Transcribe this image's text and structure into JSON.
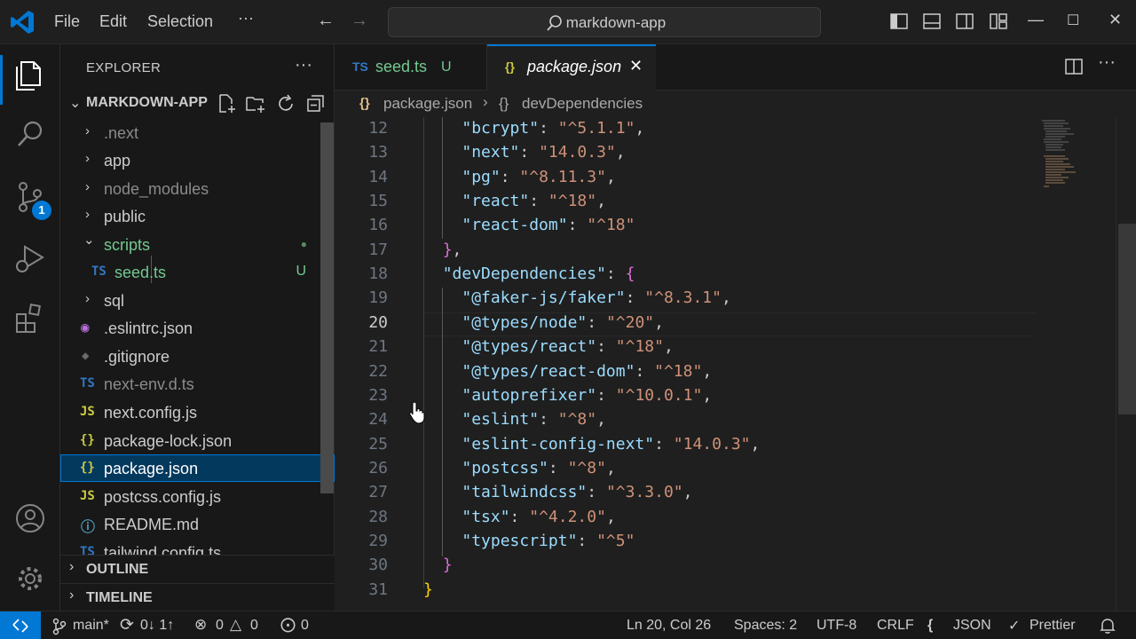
{
  "titlebar": {
    "menus": [
      "File",
      "Edit",
      "Selection",
      "···"
    ],
    "search_text": "markdown-app",
    "icons": [
      "vscode-logo-icon",
      "back-arrow-icon",
      "forward-arrow-icon",
      "search-icon",
      "toggle-primary-sidebar-icon",
      "toggle-panel-icon",
      "toggle-secondary-sidebar-icon",
      "customize-layout-icon"
    ],
    "window_controls": {
      "minimize": "—",
      "maximize": "☐",
      "close": "✕"
    }
  },
  "activitybar": {
    "items": [
      "explorer-icon",
      "search-icon",
      "source-control-icon",
      "run-debug-icon",
      "extensions-icon"
    ],
    "source_control_badge": "1",
    "bottom": [
      "accounts-icon",
      "settings-gear-icon"
    ]
  },
  "sidebar": {
    "title": "EXPLORER",
    "more": "···",
    "project": "MARKDOWN-APP",
    "items": [
      {
        "name": ".next",
        "type": "folder",
        "muted": true
      },
      {
        "name": "app",
        "type": "folder"
      },
      {
        "name": "node_modules",
        "type": "folder",
        "muted": true
      },
      {
        "name": "public",
        "type": "folder"
      },
      {
        "name": "scripts",
        "type": "folder-open",
        "decoration": "●"
      },
      {
        "name": "seed.ts",
        "type": "ts",
        "decoration": "U"
      },
      {
        "name": "sql",
        "type": "folder"
      },
      {
        "name": ".eslintrc.json",
        "type": "eslint"
      },
      {
        "name": ".gitignore",
        "type": "git"
      },
      {
        "name": "next-env.d.ts",
        "type": "ts",
        "muted": true
      },
      {
        "name": "next.config.js",
        "type": "js"
      },
      {
        "name": "package-lock.json",
        "type": "json"
      },
      {
        "name": "package.json",
        "type": "json",
        "selected": true
      },
      {
        "name": "postcss.config.js",
        "type": "js"
      },
      {
        "name": "README.md",
        "type": "info"
      },
      {
        "name": "tailwind.config.ts",
        "type": "ts"
      }
    ],
    "outline": "OUTLINE",
    "timeline": "TIMELINE"
  },
  "tabs": [
    {
      "icon": "TS",
      "label": "seed.ts",
      "status": "U",
      "active": false
    },
    {
      "icon": "{}",
      "label": "package.json",
      "close": "✕",
      "active": true
    }
  ],
  "breadcrumb": [
    "package.json",
    "devDependencies"
  ],
  "editor": {
    "current_line": 20,
    "lines": [
      {
        "n": "12",
        "key": "\"bcrypt\"",
        "val": "\"^5.1.1\"",
        "end": ","
      },
      {
        "n": "13",
        "key": "\"next\"",
        "val": "\"14.0.3\"",
        "end": ","
      },
      {
        "n": "14",
        "key": "\"pg\"",
        "val": "\"^8.11.3\"",
        "end": ","
      },
      {
        "n": "15",
        "key": "\"react\"",
        "val": "\"^18\"",
        "end": ","
      },
      {
        "n": "16",
        "key": "\"react-dom\"",
        "val": "\"^18\"",
        "end": ""
      },
      {
        "n": "17",
        "close": "},"
      },
      {
        "n": "18",
        "key": "\"devDependencies\"",
        "open": "{"
      },
      {
        "n": "19",
        "key": "\"@faker-js/faker\"",
        "val": "\"^8.3.1\"",
        "end": ","
      },
      {
        "n": "20",
        "key": "\"@types/node\"",
        "val": "\"^20\"",
        "end": ","
      },
      {
        "n": "21",
        "key": "\"@types/react\"",
        "val": "\"^18\"",
        "end": ","
      },
      {
        "n": "22",
        "key": "\"@types/react-dom\"",
        "val": "\"^18\"",
        "end": ","
      },
      {
        "n": "23",
        "key": "\"autoprefixer\"",
        "val": "\"^10.0.1\"",
        "end": ","
      },
      {
        "n": "24",
        "key": "\"eslint\"",
        "val": "\"^8\"",
        "end": ","
      },
      {
        "n": "25",
        "key": "\"eslint-config-next\"",
        "val": "\"14.0.3\"",
        "end": ","
      },
      {
        "n": "26",
        "key": "\"postcss\"",
        "val": "\"^8\"",
        "end": ","
      },
      {
        "n": "27",
        "key": "\"tailwindcss\"",
        "val": "\"^3.3.0\"",
        "end": ","
      },
      {
        "n": "28",
        "key": "\"tsx\"",
        "val": "\"^4.2.0\"",
        "end": ","
      },
      {
        "n": "29",
        "key": "\"typescript\"",
        "val": "\"^5\"",
        "end": ""
      },
      {
        "n": "30",
        "close": "}"
      },
      {
        "n": "31",
        "close": "}",
        "outer": true
      }
    ]
  },
  "statusbar": {
    "branch": "main*",
    "sync": "0↓ 1↑",
    "errors": "0",
    "warnings": "0",
    "ports": "0",
    "position": "Ln 20, Col 26",
    "spaces": "Spaces: 2",
    "encoding": "UTF-8",
    "eol": "CRLF",
    "language": "JSON",
    "formatter": "Prettier"
  },
  "colors": {
    "accent": "#0078d4",
    "key": "#9cdcfe",
    "string": "#ce9178",
    "bracket1": "#ffd700",
    "bracket2": "#da70d6",
    "untracked": "#73c991"
  }
}
